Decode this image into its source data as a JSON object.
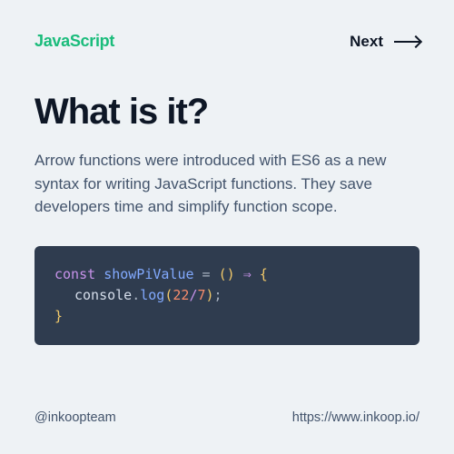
{
  "header": {
    "brand": "JavaScript",
    "next_label": "Next"
  },
  "main": {
    "title": "What is it?",
    "description": "Arrow functions were introduced with ES6 as a new syntax for writing JavaScript functions. They save developers time and simplify function scope."
  },
  "code": {
    "keyword": "const",
    "func_name": "showPiValue",
    "eq": " = ",
    "paren_open": "(",
    "paren_close": ")",
    "arrow": " ⇒ ",
    "brace_open": "  {",
    "obj": "console",
    "dot": ".",
    "method": "log",
    "call_open": "(",
    "num1": "22",
    "op": "/",
    "num2": "7",
    "call_close": ")",
    "semicolon": ";",
    "brace_close": "}"
  },
  "footer": {
    "handle": "@inkoopteam",
    "url": "https://www.inkoop.io/"
  }
}
